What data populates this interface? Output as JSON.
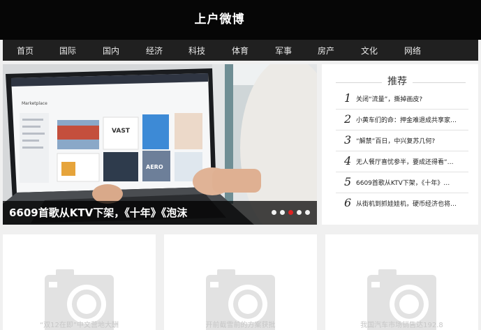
{
  "site": {
    "title": "上户微博"
  },
  "nav": {
    "items": [
      "首页",
      "国际",
      "国内",
      "经济",
      "科技",
      "体育",
      "军事",
      "房产",
      "文化",
      "网络"
    ]
  },
  "slider": {
    "caption": "6609首歌从KTV下架，《十年》《泡沫",
    "dot_count": 5,
    "active_dot": 3,
    "screen_heading": "Marketplace",
    "screen_tiles": [
      "VAST",
      "AERO"
    ]
  },
  "recommend": {
    "title": "推荐",
    "items": [
      {
        "num": "1",
        "text": "关闭“流量”，撕掉画皮?"
      },
      {
        "num": "2",
        "text": "小黄车们的命：押金难退成共享家…"
      },
      {
        "num": "3",
        "text": "“解禁”百日，中兴复苏几何?"
      },
      {
        "num": "4",
        "text": "无人餐厅喜忧参半，要成还得看“…"
      },
      {
        "num": "5",
        "text": "6609首歌从KTV下架，《十年》…"
      },
      {
        "num": "6",
        "text": "从街机到抓娃娃机，硬币经济也将…"
      }
    ]
  },
  "cards": [
    {
      "text": "“双12在即”中文营地大酬"
    },
    {
      "text": "开前截雪前的方案获批"
    },
    {
      "text": "我国汽车市场销售达192.8"
    }
  ],
  "colors": {
    "topbar": "#060606",
    "navbar": "#202020",
    "active_dot": "#e02222",
    "placeholder_icon": "#e2e2e2"
  }
}
